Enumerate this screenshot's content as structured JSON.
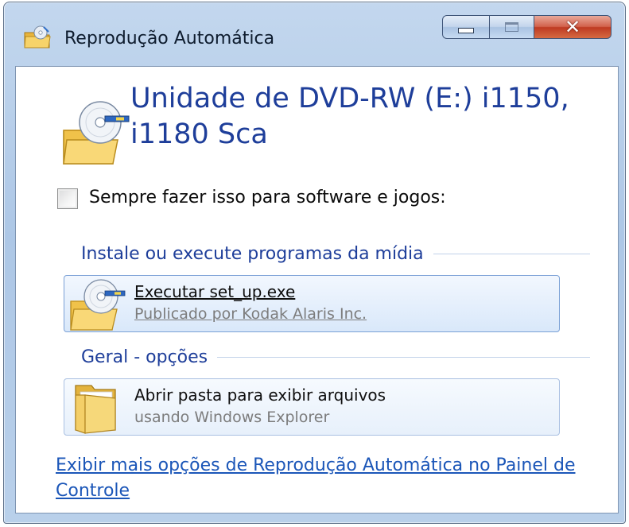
{
  "window": {
    "title": "Reprodução Automática",
    "icon": "autoplay-icon",
    "controls": {
      "minimize": "minimize-icon",
      "maximize": "maximize-icon",
      "close": "close-icon"
    }
  },
  "device": {
    "icon": "dvd-drive-icon",
    "title": "Unidade de DVD-RW (E:) i1150, i1180 Sca"
  },
  "always_option": {
    "checked": false,
    "label": "Sempre fazer isso para software e jogos:"
  },
  "groups": [
    {
      "header": "Instale ou execute programas da mídia",
      "options": [
        {
          "icon": "setup-disc-icon",
          "title": "Executar set_up.exe",
          "subtitle": "Publicado por Kodak Alaris Inc."
        }
      ]
    },
    {
      "header": "Geral - opções",
      "options": [
        {
          "icon": "folder-icon",
          "title": "Abrir pasta para exibir arquivos",
          "subtitle": "usando Windows Explorer"
        }
      ]
    }
  ],
  "footer_link": "Exibir mais opções de Reprodução Automática no Painel de Controle",
  "colors": {
    "heading_blue": "#1e3e9a",
    "link_blue": "#1b56b8",
    "frame_blue": "#adc7e6",
    "close_red": "#be3a22"
  }
}
